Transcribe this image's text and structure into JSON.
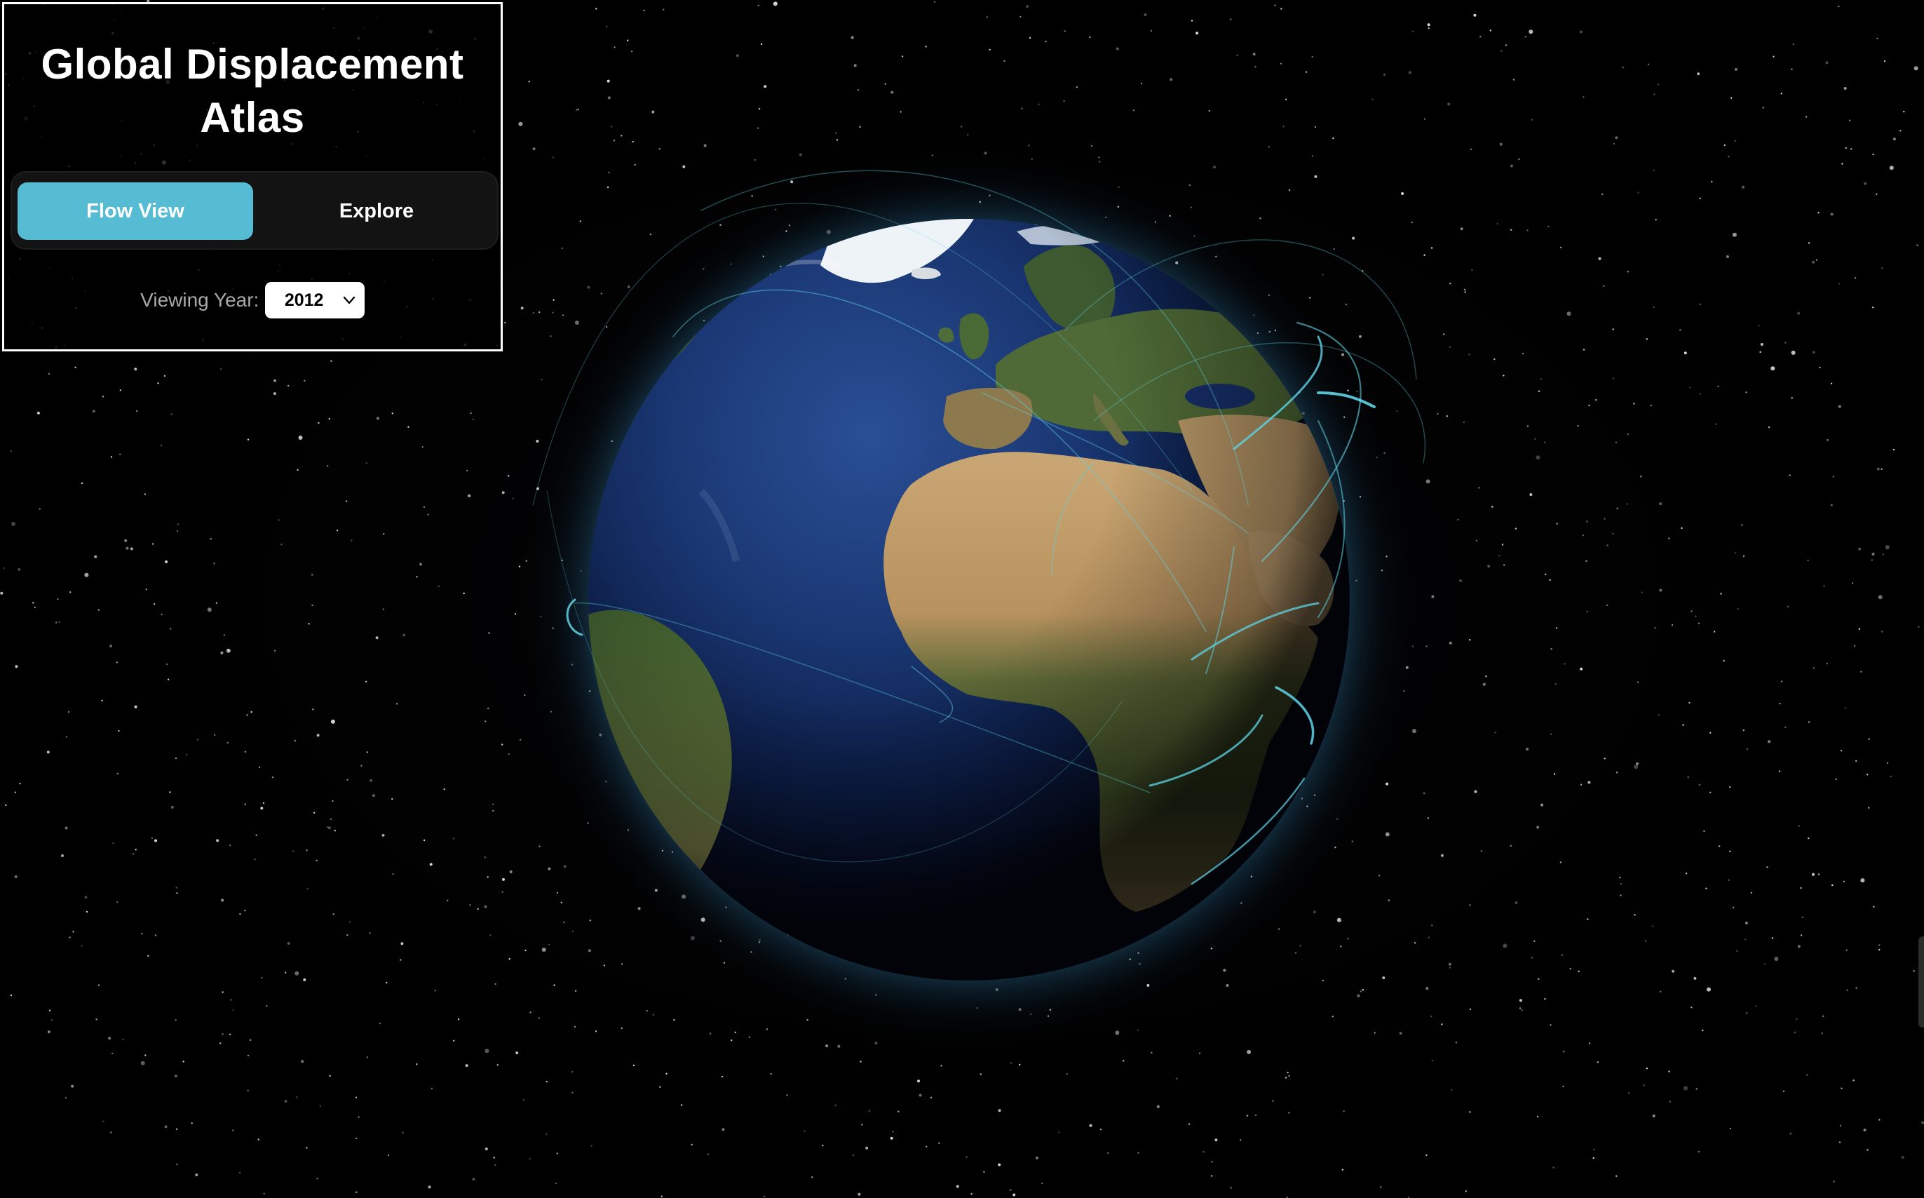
{
  "app": {
    "title": "Global Displacement Atlas"
  },
  "mode_toggle": {
    "options": [
      {
        "label": "Flow View",
        "active": true
      },
      {
        "label": "Explore",
        "active": false
      }
    ]
  },
  "year_selector": {
    "label": "Viewing Year:",
    "selected": "2012"
  },
  "colors": {
    "accent": "#55bcd4",
    "flow_lines": "#5fd3e6",
    "background": "#000000",
    "panel_border": "#ffffff"
  },
  "globe": {
    "view": "Atlantic / Europe / Africa hemisphere",
    "flow_arcs_visible": true
  }
}
